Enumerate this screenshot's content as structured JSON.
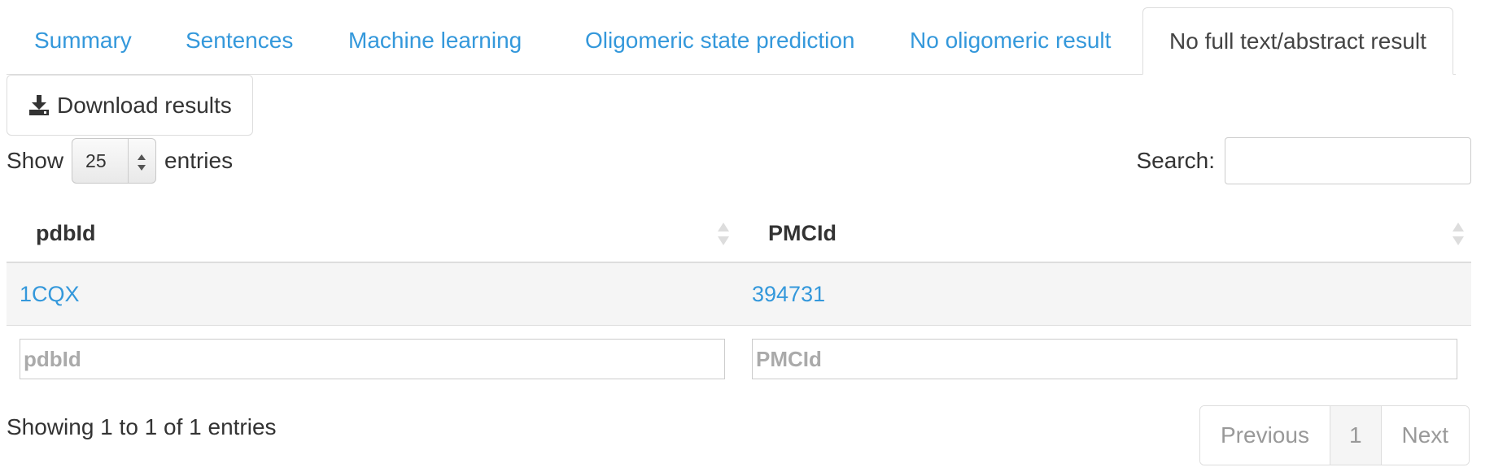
{
  "tabs": [
    {
      "label": "Summary"
    },
    {
      "label": "Sentences"
    },
    {
      "label": "Machine learning"
    },
    {
      "label": "Oligomeric state prediction"
    },
    {
      "label": "No oligomeric result"
    },
    {
      "label": "No full text/abstract result",
      "active": true
    }
  ],
  "toolbar": {
    "download_label": "Download results",
    "download_icon": "download-icon"
  },
  "length": {
    "show_label": "Show",
    "selected": "25",
    "entries_label": "entries"
  },
  "search": {
    "label": "Search:",
    "value": ""
  },
  "table": {
    "columns": [
      "pdbId",
      "PMCId"
    ],
    "rows": [
      [
        "1CQX",
        "394731"
      ]
    ],
    "filters": [
      {
        "placeholder": "pdbId"
      },
      {
        "placeholder": "PMCId"
      }
    ]
  },
  "info": "Showing 1 to 1 of 1 entries",
  "pagination": {
    "previous": "Previous",
    "current": "1",
    "next": "Next"
  },
  "colors": {
    "link": "#3498db",
    "border": "#dddddd",
    "row_bg": "#f5f5f5"
  }
}
